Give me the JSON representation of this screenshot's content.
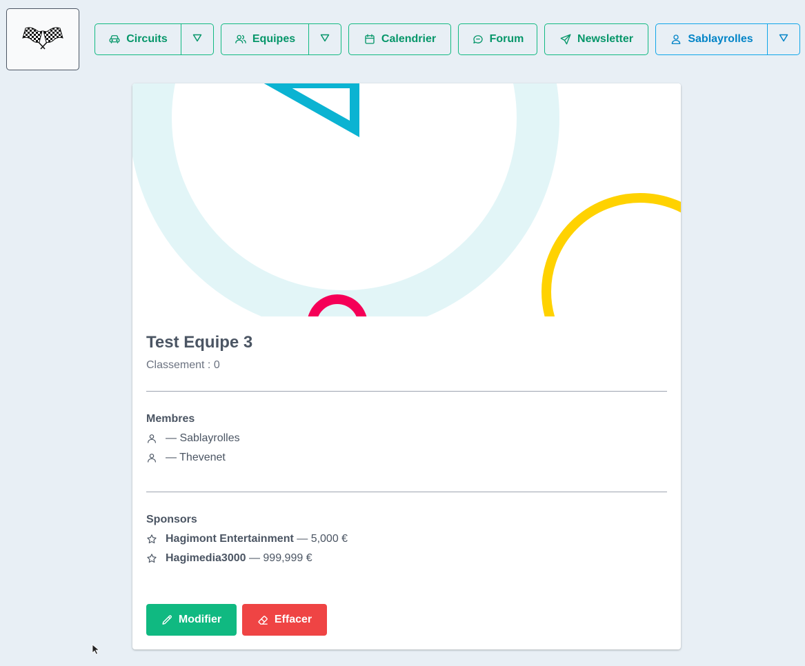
{
  "nav": {
    "circuits_label": "Circuits",
    "equipes_label": "Equipes",
    "calendrier_label": "Calendrier",
    "forum_label": "Forum",
    "newsletter_label": "Newsletter",
    "user_label": "Sablayrolles"
  },
  "team": {
    "name": "Test Equipe 3",
    "ranking": "Classement : 0"
  },
  "members": {
    "title": "Membres",
    "items": [
      {
        "name": "— Sablayrolles"
      },
      {
        "name": "— Thevenet"
      }
    ]
  },
  "sponsors": {
    "title": "Sponsors",
    "items": [
      {
        "name": "Hagimont Entertainment",
        "amount": " — 5,000 €"
      },
      {
        "name": "Hagimedia3000",
        "amount": " — 999,999 €"
      }
    ]
  },
  "actions": {
    "edit_label": "Modifier",
    "delete_label": "Effacer"
  },
  "colors": {
    "accent_green": "#10b981",
    "accent_blue": "#0ea5e9",
    "edit_bg": "#10b981",
    "delete_bg": "#ef4444",
    "background": "#e8eff5"
  },
  "icons": {
    "logo": "checkered-flags-icon",
    "circuits": "car-icon",
    "equipes": "users-icon",
    "calendrier": "calendar-icon",
    "forum": "chat-icon",
    "newsletter": "send-icon",
    "user": "user-icon",
    "member": "user-icon",
    "sponsor": "star-icon",
    "edit": "pencil-icon",
    "delete": "eraser-icon"
  }
}
